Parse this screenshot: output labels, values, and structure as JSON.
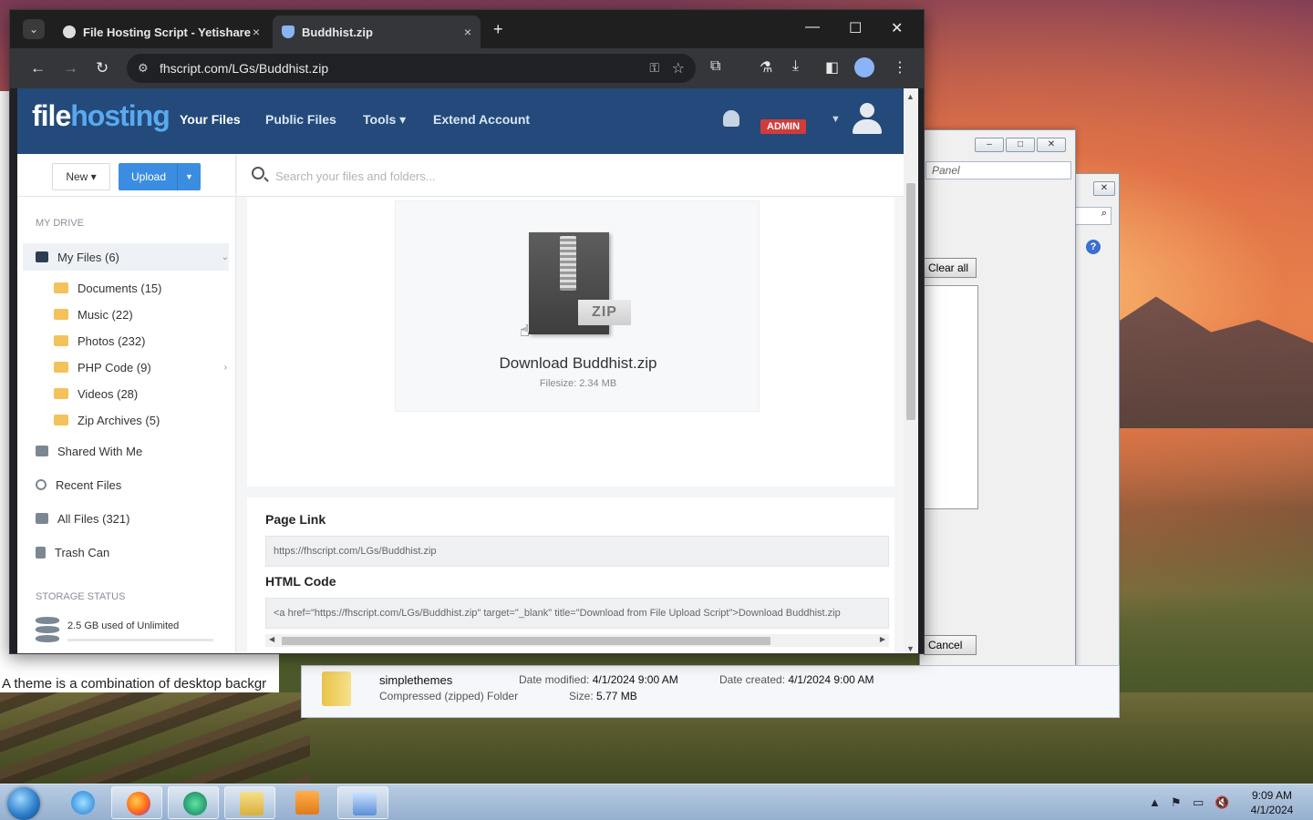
{
  "browser": {
    "tabs": [
      {
        "title": "File Hosting Script - Yetishare",
        "close": "×"
      },
      {
        "title": "Buddhist.zip",
        "close": "×"
      }
    ],
    "new_tab": "+",
    "window_controls": {
      "minimize": "—",
      "maximize": "☐",
      "close": "✕"
    },
    "address": "fhscript.com/LGs/Buddhist.zip"
  },
  "site": {
    "logo_part1": "file",
    "logo_part2": "hosting",
    "nav": [
      "Your Files",
      "Public Files",
      "Tools ▾",
      "Extend Account"
    ],
    "admin_badge": "ADMIN"
  },
  "sidebar": {
    "new_label": "New ▾",
    "upload_label": "Upload",
    "my_drive": "MY DRIVE",
    "my_files": "My Files (6)",
    "folders": [
      "Documents (15)",
      "Music (22)",
      "Photos (232)",
      "PHP Code (9)",
      "Videos (28)",
      "Zip Archives (5)"
    ],
    "shared": "Shared With Me",
    "recent": "Recent Files",
    "all_files": "All Files (321)",
    "trash": "Trash Can",
    "storage_status": "STORAGE STATUS",
    "storage_used": "2.5 GB used of Unlimited"
  },
  "search": {
    "placeholder": "Search your files and folders..."
  },
  "file": {
    "zip_tag": "ZIP",
    "download_title": "Download Buddhist.zip",
    "filesize": "Filesize: 2.34 MB"
  },
  "links": {
    "page_link_label": "Page Link",
    "page_link_value": "https://fhscript.com/LGs/Buddhist.zip",
    "html_code_label": "HTML Code",
    "html_code_value": "<a href=\"https://fhscript.com/LGs/Buddhist.zip\" target=\"_blank\" title=\"Download from File Upload Script\">Download Buddhist.zip"
  },
  "background_windows": {
    "panel_search": "Panel",
    "clear_all": "Clear all",
    "cancel": "Cancel",
    "left_text": "A theme is a combination of desktop backgr",
    "explorer": {
      "name": "simplethemes",
      "type": "Compressed (zipped) Folder",
      "date_modified_label": "Date modified:",
      "date_modified": "4/1/2024 9:00 AM",
      "size_label": "Size:",
      "size": "5.77 MB",
      "date_created_label": "Date created:",
      "date_created": "4/1/2024 9:00 AM"
    }
  },
  "taskbar": {
    "time": "9:09 AM",
    "date": "4/1/2024"
  }
}
